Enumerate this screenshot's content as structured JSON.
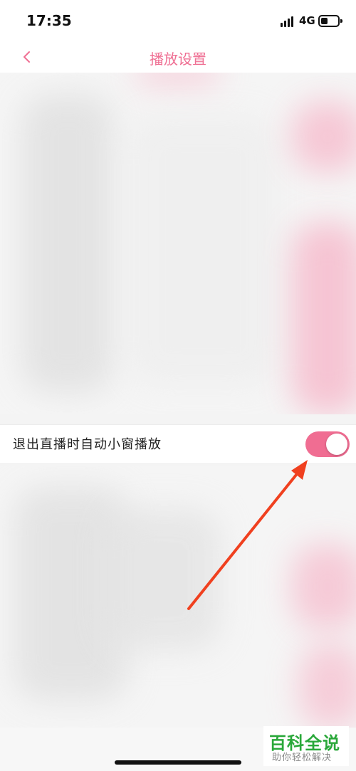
{
  "status_bar": {
    "time": "17:35",
    "network": "4G",
    "signal_icon": "signal-bars-icon",
    "battery_icon": "battery-icon",
    "battery_level": 0.4
  },
  "nav": {
    "title": "播放设置",
    "back_icon": "chevron-left-icon"
  },
  "settings": {
    "auto_mini_play": {
      "label": "退出直播时自动小窗播放",
      "enabled": true
    }
  },
  "watermark": {
    "main": "百科全说",
    "sub": "助你轻松解决"
  },
  "colors": {
    "accent": "#f06d92",
    "title": "#ef6f93",
    "annotation_arrow": "#f0401f",
    "watermark": "#2aa83a"
  }
}
